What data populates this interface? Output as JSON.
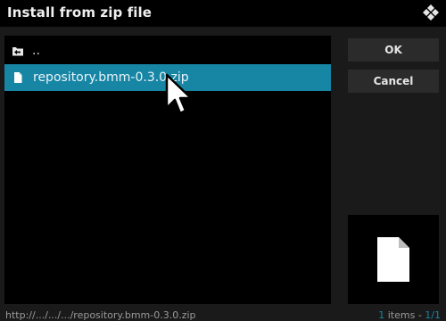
{
  "window": {
    "title": "Install from zip file"
  },
  "list": {
    "items": [
      {
        "label": "..",
        "icon": "folder-back-icon"
      },
      {
        "label": "repository.bmm-0.3.0.zip",
        "icon": "file-icon",
        "selected": true
      }
    ]
  },
  "buttons": {
    "ok_label": "OK",
    "cancel_label": "Cancel"
  },
  "footer": {
    "path": "http://.../.../.../repository.bmm-0.3.0.zip",
    "count_prefix": "1",
    "count_text": " items - ",
    "page": "1/1"
  },
  "colors": {
    "accent": "#1785a4",
    "background": "#1a1a1a",
    "panel": "#000000",
    "button": "#2b2b2b"
  }
}
